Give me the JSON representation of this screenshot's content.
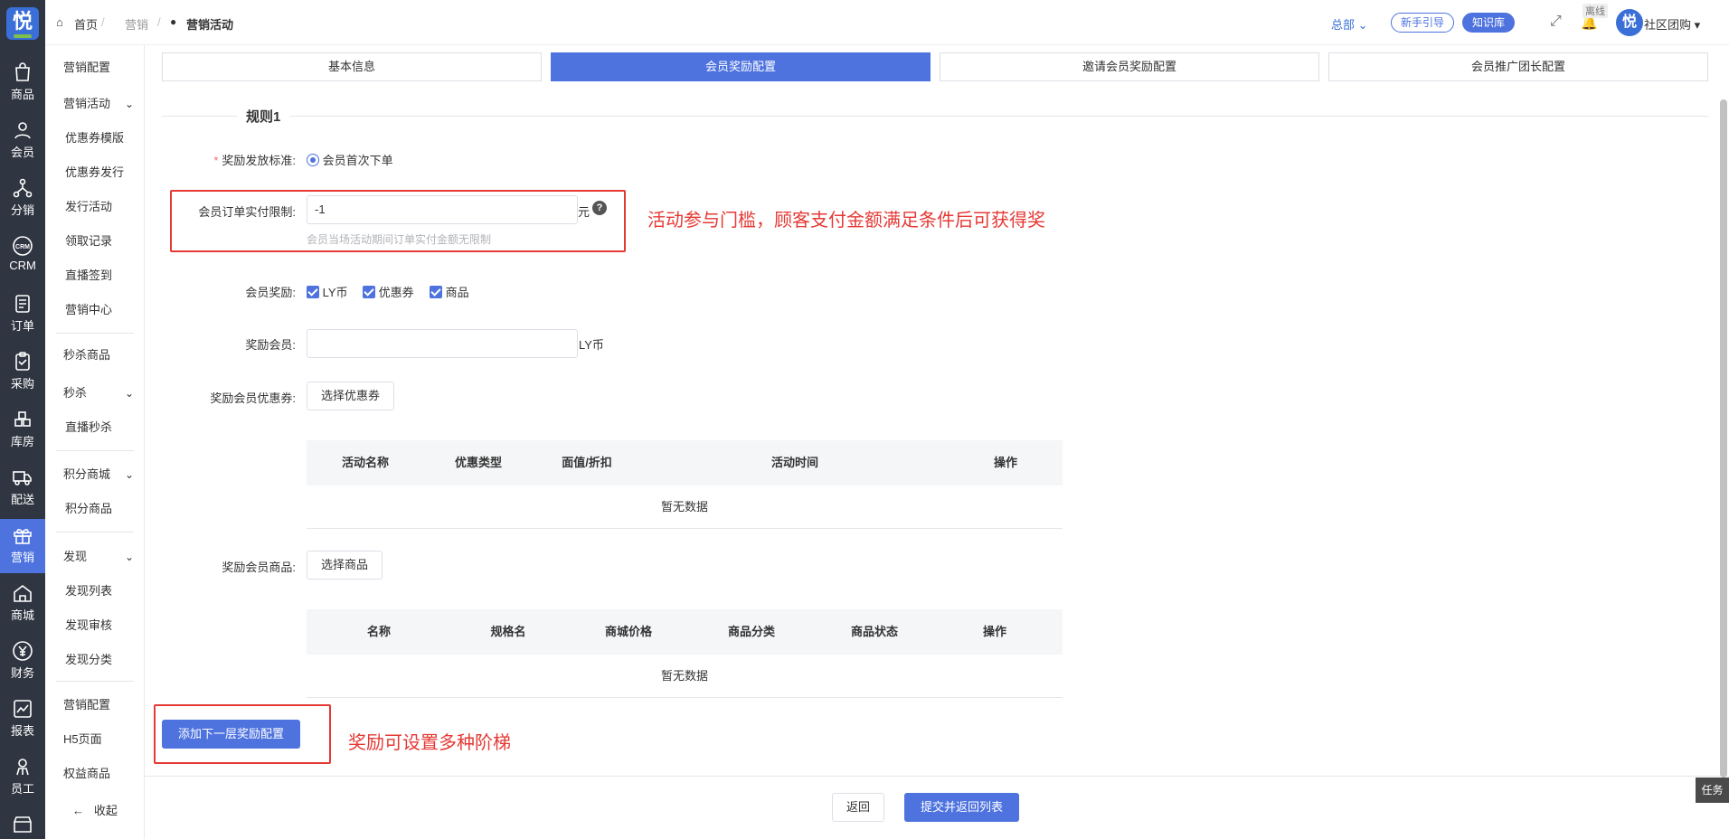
{
  "sidebar": {
    "items": [
      {
        "icon": "bag-icon",
        "label": "商品"
      },
      {
        "icon": "user-icon",
        "label": "会员"
      },
      {
        "icon": "share-icon",
        "label": "分销"
      },
      {
        "icon": "crm-icon",
        "label": "CRM"
      },
      {
        "icon": "order-icon",
        "label": "订单"
      },
      {
        "icon": "clipboard-icon",
        "label": "采购"
      },
      {
        "icon": "grid-icon",
        "label": "库房"
      },
      {
        "icon": "truck-icon",
        "label": "配送"
      },
      {
        "icon": "gift-icon",
        "label": "营销"
      },
      {
        "icon": "home-icon",
        "label": "商城"
      },
      {
        "icon": "yen-icon",
        "label": "财务"
      },
      {
        "icon": "chart-icon",
        "label": "报表"
      },
      {
        "icon": "staff-icon",
        "label": "员工"
      }
    ]
  },
  "submenu": {
    "items": [
      "营销配置",
      "营销活动",
      "优惠券模版",
      "优惠券发行",
      "发行活动",
      "领取记录",
      "直播签到",
      "营销中心",
      "秒杀商品",
      "秒杀",
      "直播秒杀",
      "积分商城",
      "积分商品",
      "发现",
      "发现列表",
      "发现审核",
      "发现分类",
      "营销配置",
      "H5页面",
      "权益商品"
    ],
    "collapse": "收起"
  },
  "topbar": {
    "breadcrumb": [
      "首页",
      "营销",
      "营销活动"
    ],
    "region": "总部",
    "guide": "新手引导",
    "kb": "知识库",
    "offline": "离线",
    "store": "社区团购"
  },
  "tabs": [
    "基本信息",
    "会员奖励配置",
    "邀请会员奖励配置",
    "会员推广团长配置"
  ],
  "rule": {
    "title": "规则1",
    "standard_label": "奖励发放标准:",
    "standard_value": "会员首次下单",
    "limit_label": "会员订单实付限制:",
    "limit_value": "-1",
    "limit_unit": "元",
    "limit_hint": "会员当场活动期间订单实付金额无限制",
    "reward_label": "会员奖励:",
    "reward_options": [
      "LY币",
      "优惠券",
      "商品"
    ],
    "reward_member_label": "奖励会员:",
    "reward_member_unit": "LY币",
    "coupon_label": "奖励会员优惠券:",
    "coupon_btn": "选择优惠券",
    "coupon_table": {
      "columns": [
        "活动名称",
        "优惠类型",
        "面值/折扣",
        "活动时间",
        "操作"
      ],
      "empty": "暂无数据"
    },
    "goods_label": "奖励会员商品:",
    "goods_btn": "选择商品",
    "goods_table": {
      "columns": [
        "名称",
        "规格名",
        "商城价格",
        "商品分类",
        "商品状态",
        "操作"
      ],
      "empty": "暂无数据"
    },
    "add_btn": "添加下一层奖励配置"
  },
  "annotations": {
    "threshold": "活动参与门槛，顾客支付金额满足条件后可获得奖",
    "tiers": "奖励可设置多种阶梯"
  },
  "footer": {
    "back": "返回",
    "submit": "提交并返回列表"
  },
  "task": "任务",
  "colors": {
    "primary": "#4e73df",
    "sidebar": "#2f3541",
    "annotation": "#e53935"
  }
}
